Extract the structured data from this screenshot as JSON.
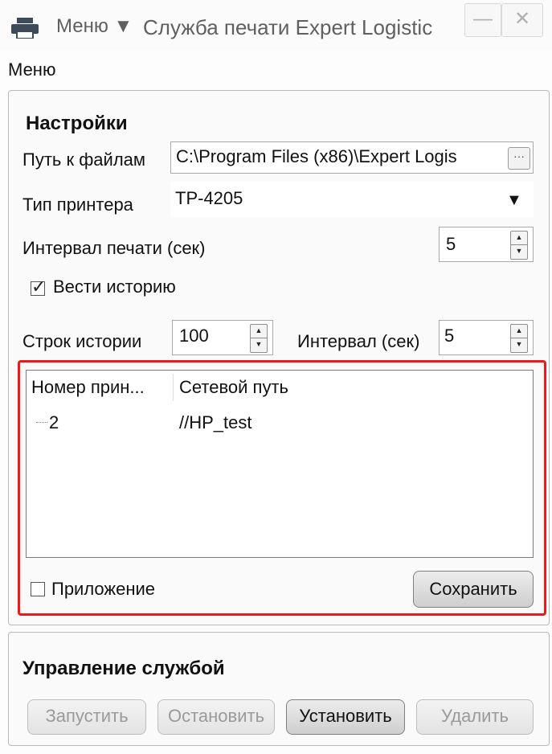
{
  "window": {
    "menu_button": "Меню ▼",
    "title": "Служба печати Expert Logistic",
    "minimize_glyph": "—",
    "close_glyph": "✕"
  },
  "menubar": {
    "menu": "Меню"
  },
  "settings": {
    "title": "Настройки",
    "path_label": "Путь к файлам",
    "path_value": "C:\\Program Files (x86)\\Expert Logis",
    "browse_glyph": "···",
    "printer_type_label": "Тип принтера",
    "printer_type_value": "TP-4205",
    "dropdown_glyph": "▼",
    "print_interval_label": "Интервал печати (сек)",
    "print_interval_value": "5",
    "history_label": "Вести историю",
    "history_checked": true,
    "history_rows_label": "Строк истории",
    "history_rows_value": "100",
    "interval_label": "Интервал (сек)",
    "interval_value": "5"
  },
  "printers_table": {
    "columns": [
      "Номер прин...",
      "Сетевой путь"
    ],
    "rows": [
      {
        "number": "2",
        "path": "//HP_test"
      }
    ]
  },
  "app_checkbox_label": "Приложение",
  "app_checked": false,
  "save_button": "Сохранить",
  "service": {
    "title": "Управление службой",
    "start": "Запустить",
    "stop": "Остановить",
    "install": "Установить",
    "delete": "Удалить"
  },
  "spinner_glyphs": {
    "up": "▲",
    "down": "▼"
  }
}
